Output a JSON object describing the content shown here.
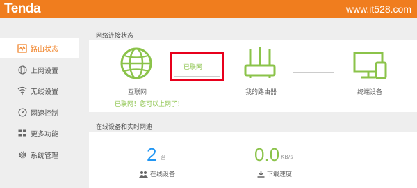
{
  "header": {
    "logo": "Tenda",
    "watermark": "www.it528.com"
  },
  "sidebar": {
    "items": [
      {
        "label": "路由状态",
        "icon": "router-status-icon",
        "active": true
      },
      {
        "label": "上网设置",
        "icon": "globe-icon",
        "active": false
      },
      {
        "label": "无线设置",
        "icon": "wifi-icon",
        "active": false
      },
      {
        "label": "网速控制",
        "icon": "speedometer-icon",
        "active": false
      },
      {
        "label": "更多功能",
        "icon": "grid-icon",
        "active": false
      },
      {
        "label": "系统管理",
        "icon": "gear-icon",
        "active": false
      }
    ]
  },
  "network_status": {
    "title": "网络连接状态",
    "internet_label": "互联网",
    "connection_state": "已联网",
    "router_label": "我的路由器",
    "devices_label": "终端设备",
    "status_message": "已联网！您可以上网了！"
  },
  "online_devices": {
    "title": "在线设备和实时网速",
    "device_count": "2",
    "device_unit": "台",
    "device_label": "在线设备",
    "download_speed": "0.0",
    "speed_unit": "KB/s",
    "download_label": "下载速度"
  },
  "colors": {
    "brand": "#f07d1e",
    "green": "#8bc34a",
    "blue": "#2196f3",
    "highlight": "#e8001c"
  }
}
